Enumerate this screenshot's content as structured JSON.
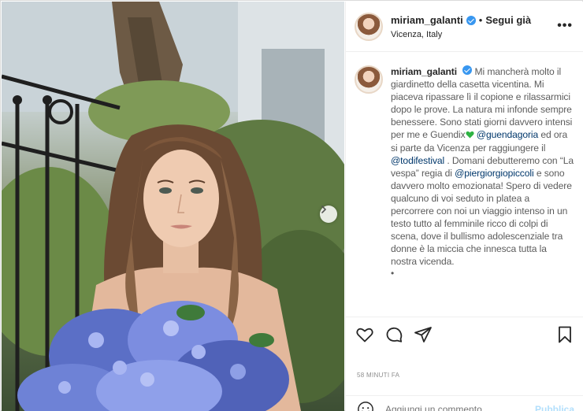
{
  "post": {
    "username": "miriam_galanti",
    "follow_status": "Segui già",
    "separator": "•",
    "location": "Vicenza, Italy",
    "more_icon": "ellipsis-icon",
    "caption": {
      "part1": "Mi mancherà molto il giardinetto della casetta vicentina. Mi piaceva ripassare lì il copione e rilassarmici dopo le prove. La natura mi infonde sempre benessere. Sono stati giorni davvero intensi per me e Guendix",
      "mention1": "@guendagoria",
      "part2": " ed ora si parte da Vicenza per raggiungere il ",
      "mention2": "@todifestival",
      "part3": " . Domani debutteremo con “La vespa” regia di ",
      "mention3": "@piergiorgiopiccoli",
      "part4": " e sono davvero molto emozionata! Spero di vedere qualcuno di voi seduto in platea a percorrere con noi un viaggio intenso in un testo tutto al femminile ricco di colpi di scena, dove il bullismo adolescenziale tra donne è la miccia che innesca tutta la nostra vicenda.",
      "bullet": "•"
    },
    "timestamp": "58 MINUTI FA",
    "comment_placeholder": "Aggiungi un commento...",
    "publish_label": "Pubblica"
  },
  "icons": {
    "verified": "verified-badge-icon",
    "green_heart": "green-heart-emoji",
    "like": "heart-icon",
    "comment": "comment-icon",
    "share": "paper-plane-icon",
    "save": "bookmark-icon",
    "emoji": "smiley-icon",
    "next": "chevron-right-icon"
  },
  "colors": {
    "mention": "#00376b",
    "verified": "#3897f0",
    "green_heart": "#2fb344",
    "publish_disabled": "#b2dffc"
  }
}
